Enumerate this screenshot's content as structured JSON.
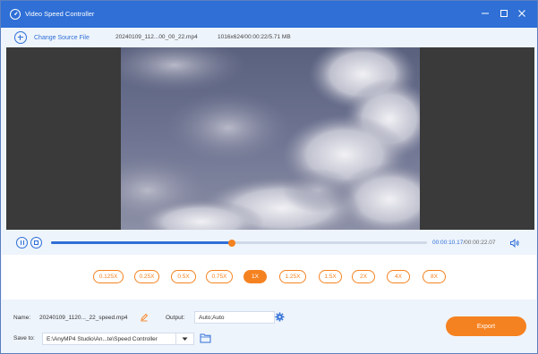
{
  "window": {
    "title": "Video Speed Controller",
    "accent_color": "#2f6fd6",
    "highlight_color": "#f58220"
  },
  "toolbar": {
    "change_source_label": "Change Source File",
    "filename": "20240109_112...00_00_22.mp4",
    "fileinfo": "1016x624/00:00:22/5.71 MB"
  },
  "player": {
    "current_time": "00:00:10.17",
    "separator": "/",
    "total_time": "00:00:22.07",
    "progress_fraction": 0.48
  },
  "speeds": {
    "options": [
      "0.125X",
      "0.25X",
      "0.5X",
      "0.75X",
      "1X",
      "1.25X",
      "1.5X",
      "2X",
      "4X",
      "8X"
    ],
    "selected": "1X"
  },
  "output_panel": {
    "name_label": "Name:",
    "name_value": "20240109_1120..._22_speed.mp4",
    "output_label": "Output:",
    "output_value": "Auto;Auto",
    "save_to_label": "Save to:",
    "save_to_value": "E:\\AnyMP4 Studio\\An...te\\Speed Controller",
    "export_label": "Export"
  }
}
